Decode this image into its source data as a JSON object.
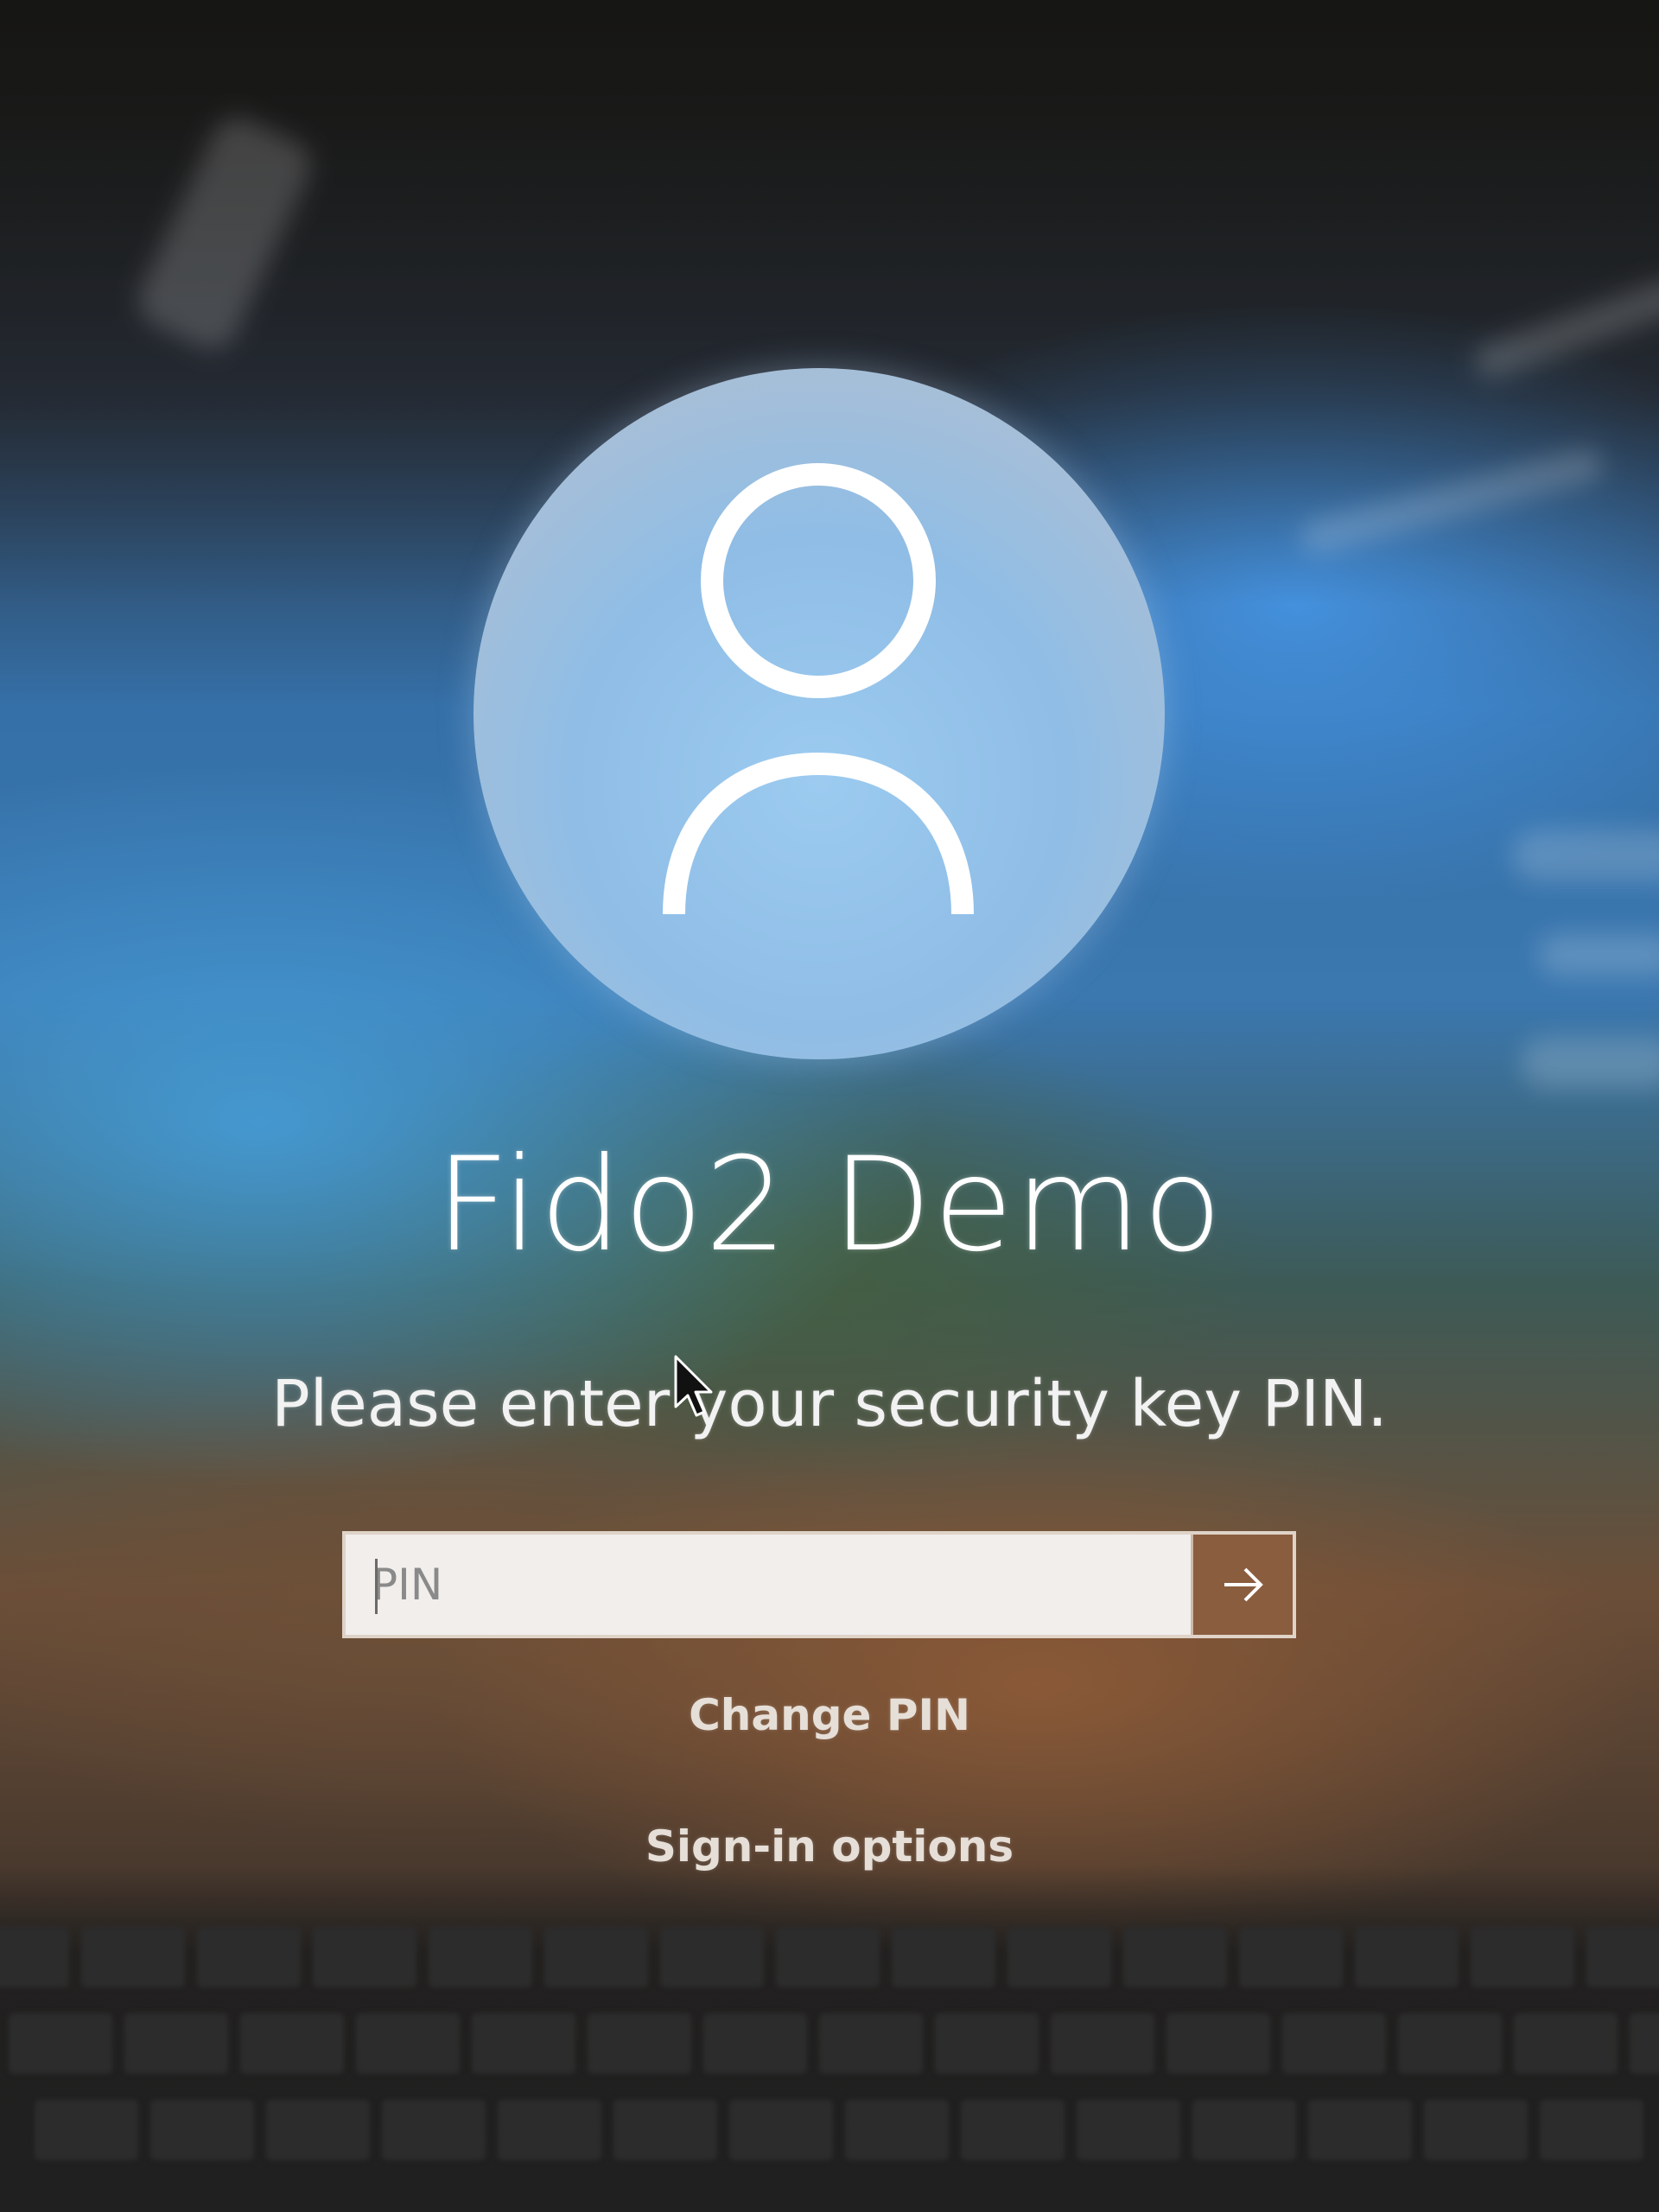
{
  "account": {
    "username": "Fido2 Demo",
    "avatar_icon": "user-silhouette-icon"
  },
  "prompt": {
    "text": "Please enter your security key PIN."
  },
  "pin_field": {
    "placeholder": "PIN",
    "value": "",
    "submit_icon": "arrow-right-icon"
  },
  "links": {
    "change_pin": "Change PIN",
    "sign_in_options": "Sign-in options"
  },
  "colors": {
    "submit_button": "#8a5d3f",
    "text": "#ffffff"
  }
}
